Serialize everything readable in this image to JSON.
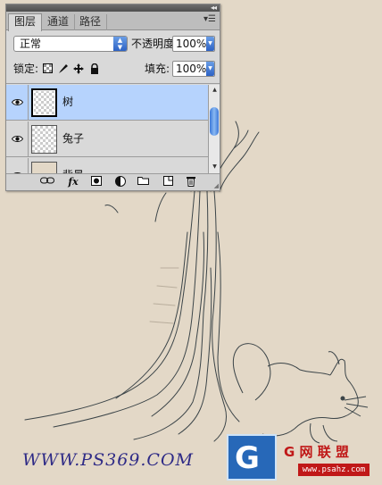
{
  "panel": {
    "collapse_label": "◂◂",
    "tabs": [
      {
        "label": "图层",
        "active": true
      },
      {
        "label": "通道",
        "active": false
      },
      {
        "label": "路径",
        "active": false
      }
    ],
    "menu_icon": "panel-menu-icon",
    "blend_mode": "正常",
    "opacity_label": "不透明度:",
    "opacity_value": "100%",
    "lock_label": "锁定:",
    "fill_label": "填充:",
    "fill_value": "100%",
    "layers": [
      {
        "name": "树",
        "selected": true,
        "visible": true,
        "thumbnail": "transparent"
      },
      {
        "name": "兔子",
        "selected": false,
        "visible": true,
        "thumbnail": "transparent"
      },
      {
        "name": "背景",
        "selected": false,
        "visible": true,
        "thumbnail": "background"
      }
    ],
    "bottom_icons": [
      "link-layers-icon",
      "fx-icon",
      "add-mask-icon",
      "adjustment-layer-icon",
      "new-group-icon",
      "new-layer-icon",
      "delete-layer-icon"
    ],
    "fx_label": "fx"
  },
  "canvas": {
    "background_color": "#e3d8c7",
    "watermark_text": "WWW.PS369.COM",
    "logo_letter": "G",
    "logo_cn_text": "G 网 联 盟",
    "logo_url_text": "www.psahz.com"
  }
}
